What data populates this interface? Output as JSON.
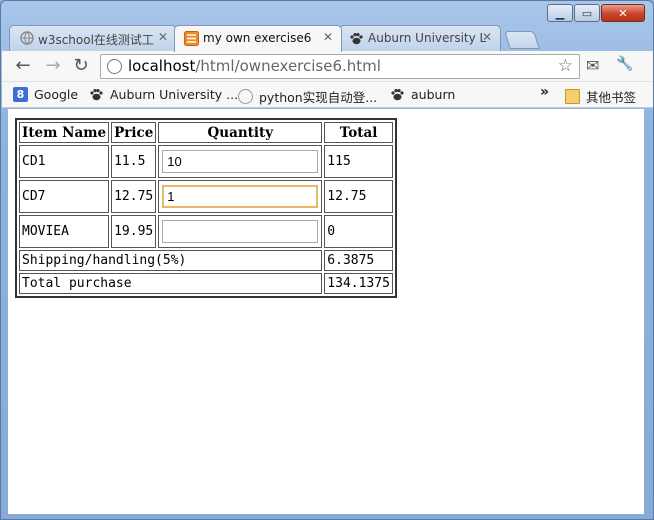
{
  "window": {
    "minimize": "▁",
    "maximize": "▭",
    "close": "✕"
  },
  "tabs": [
    {
      "label": "w3school在线测试工",
      "icon": "globe-icon",
      "close": "✕"
    },
    {
      "label": "my own exercise6",
      "icon": "html-icon",
      "close": "✕"
    },
    {
      "label": "Auburn University L",
      "icon": "paw-icon",
      "close": "✕"
    }
  ],
  "toolbar": {
    "back": "←",
    "forward": "→",
    "reload": "↻",
    "url_host": "localhost",
    "url_path": "/html/ownexercise6.html",
    "star": "☆",
    "ext_mail": "✉",
    "wrench": "🔧"
  },
  "bookmarks": {
    "items": [
      {
        "label": "Google",
        "icon": "google-icon"
      },
      {
        "label": "Auburn University ...",
        "icon": "paw-icon"
      },
      {
        "label": "python实现自动登...",
        "icon": "globe-icon"
      },
      {
        "label": "auburn",
        "icon": "paw-icon"
      }
    ],
    "overflow": "»",
    "other": "其他书签"
  },
  "table": {
    "headers": [
      "Item Name",
      "Price",
      "Quantity",
      "Total"
    ],
    "rows": [
      {
        "name": "CD1",
        "price": "11.5",
        "quantity": "10",
        "total": "115"
      },
      {
        "name": "CD7",
        "price": "12.75",
        "quantity": "1",
        "total": "12.75"
      },
      {
        "name": "MOVIEA",
        "price": "19.95",
        "quantity": "",
        "total": "0"
      }
    ],
    "shipping_label": "Shipping/handling(5%)",
    "shipping_value": "6.3875",
    "total_label": "Total purchase",
    "total_value": "134.1375"
  }
}
